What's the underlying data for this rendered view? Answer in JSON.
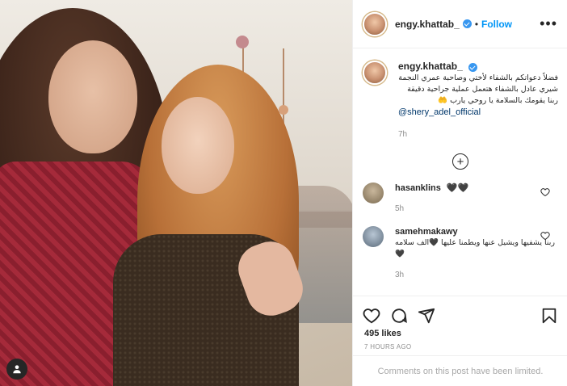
{
  "post": {
    "username": "engy.khattab_",
    "follow_label": "Follow",
    "separator": "•",
    "more_label": "•••",
    "caption": {
      "username": "engy.khattab_",
      "text": "فضلاً دعواتكم بالشفاء لأختي وصاحبة عمري النجمة شيري عادل بالشفاء هتعمل عملية جراحية دقيقة ربنا يقومك بالسلامة يا روحي يارب 🤲",
      "mention": "@shery_adel_official",
      "time": "7h"
    },
    "comments": [
      {
        "username": "hasanklins",
        "text": "🖤🖤",
        "time": "5h"
      },
      {
        "username": "samehmakawy",
        "text": "ربنا يشفيها ويشيل عنها ويطمنا عليها 🖤الف سلامه🖤",
        "time": "3h"
      }
    ],
    "likes": "495 likes",
    "posted_ago": "7 HOURS AGO",
    "comments_limited": "Comments on this post have been limited."
  },
  "colors": {
    "link_blue": "#0095f6",
    "verified_blue": "#3897f0",
    "muted_gray": "#8e8e8e"
  },
  "icons": [
    "verified-icon",
    "more-icon",
    "add-comments-icon",
    "like-icon",
    "comment-icon",
    "share-icon",
    "bookmark-icon",
    "user-tag-icon"
  ]
}
